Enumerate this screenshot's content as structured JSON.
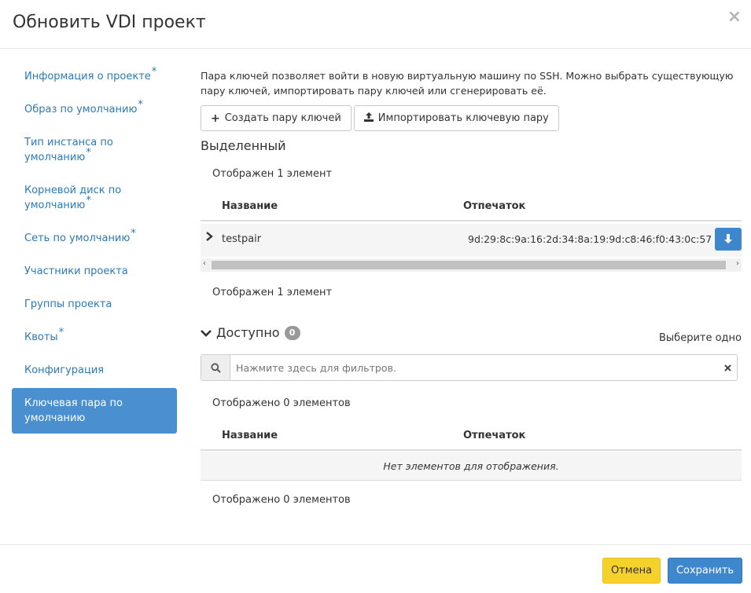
{
  "modal": {
    "title": "Обновить VDI проект",
    "close_icon": "×"
  },
  "sidebar": {
    "items": [
      {
        "label": "Информация о проекте",
        "required": "*"
      },
      {
        "label": "Образ по умолчанию",
        "required": "*"
      },
      {
        "label": "Тип инстанса по умолчанию",
        "required": "*"
      },
      {
        "label": "Корневой диск по умолчанию",
        "required": "*"
      },
      {
        "label": "Сеть по умолчанию",
        "required": "*"
      },
      {
        "label": "Участники проекта",
        "required": ""
      },
      {
        "label": "Группы проекта",
        "required": ""
      },
      {
        "label": "Квоты",
        "required": "*"
      },
      {
        "label": "Конфигурация",
        "required": ""
      },
      {
        "label": "Ключевая пара по умолчанию",
        "required": "",
        "active": true
      }
    ]
  },
  "main": {
    "help_text": "Пара ключей позволяет войти в новую виртуальную машину по SSH. Можно выбрать существующую пару ключей, импортировать пару ключей или сгенерировать её.",
    "create_button": "Создать пару ключей",
    "import_button": "Импортировать ключевую пару",
    "selected": {
      "title": "Выделенный",
      "count_top": "Отображен 1 элемент",
      "columns": [
        "Название",
        "Отпечаток"
      ],
      "rows": [
        {
          "name": "testpair",
          "fingerprint": "9d:29:8c:9a:16:2d:34:8a:19:9d:c8:46:f0:43:0c:57"
        }
      ],
      "count_bottom": "Отображен 1 элемент"
    },
    "available": {
      "title": "Доступно",
      "badge": "0",
      "choose_one": "Выберите одно",
      "filter_placeholder": "Нажмите здесь для фильтров.",
      "count_top": "Отображено 0 элементов",
      "columns": [
        "Название",
        "Отпечаток"
      ],
      "empty_text": "Нет элементов для отображения.",
      "count_bottom": "Отображено 0 элементов"
    }
  },
  "footer": {
    "cancel": "Отмена",
    "save": "Сохранить"
  },
  "colors": {
    "primary": "#3f87cc",
    "warning": "#f5d12b",
    "link": "#2a7ab8"
  }
}
